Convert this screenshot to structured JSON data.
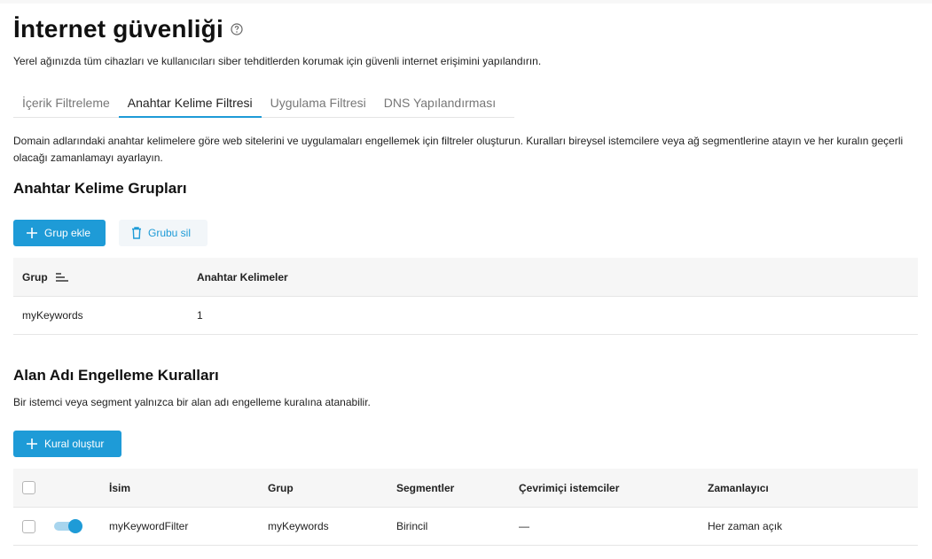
{
  "page": {
    "title": "İnternet güvenliği",
    "subtitle": "Yerel ağınızda tüm cihazları ve kullanıcıları siber tehditlerden korumak için güvenli internet erişimini yapılandırın."
  },
  "tabs": [
    {
      "label": "İçerik Filtreleme",
      "active": false
    },
    {
      "label": "Anahtar Kelime Filtresi",
      "active": true
    },
    {
      "label": "Uygulama Filtresi",
      "active": false
    },
    {
      "label": "DNS Yapılandırması",
      "active": false
    }
  ],
  "description": "Domain adlarındaki anahtar kelimelere göre web sitelerini ve uygulamaları engellemek için filtreler oluşturun. Kuralları bireysel istemcilere veya ağ segmentlerine atayın ve her kuralın geçerli olacağı zamanlamayı ayarlayın.",
  "keyword_groups": {
    "title": "Anahtar Kelime Grupları",
    "add_button": "Grup ekle",
    "delete_button": "Grubu sil",
    "columns": {
      "group": "Grup",
      "keywords": "Anahtar Kelimeler"
    },
    "rows": [
      {
        "group": "myKeywords",
        "keywords": "1"
      }
    ]
  },
  "block_rules": {
    "title": "Alan Adı Engelleme Kuralları",
    "subtitle": "Bir istemci veya segment yalnızca bir alan adı engelleme kuralına atanabilir.",
    "create_button": "Kural oluştur",
    "columns": {
      "name": "İsim",
      "group": "Grup",
      "segments": "Segmentler",
      "online_clients": "Çevrimiçi istemciler",
      "scheduler": "Zamanlayıcı"
    },
    "rows": [
      {
        "enabled": true,
        "name": "myKeywordFilter",
        "group": "myKeywords",
        "segments": "Birincil",
        "online_clients": "—",
        "scheduler": "Her zaman açık"
      }
    ]
  },
  "colors": {
    "accent": "#1e9bd7",
    "toggle_track": "#a8d5ee"
  },
  "icons": [
    "help-circle-icon",
    "plus-icon",
    "trash-icon",
    "sort-icon"
  ]
}
